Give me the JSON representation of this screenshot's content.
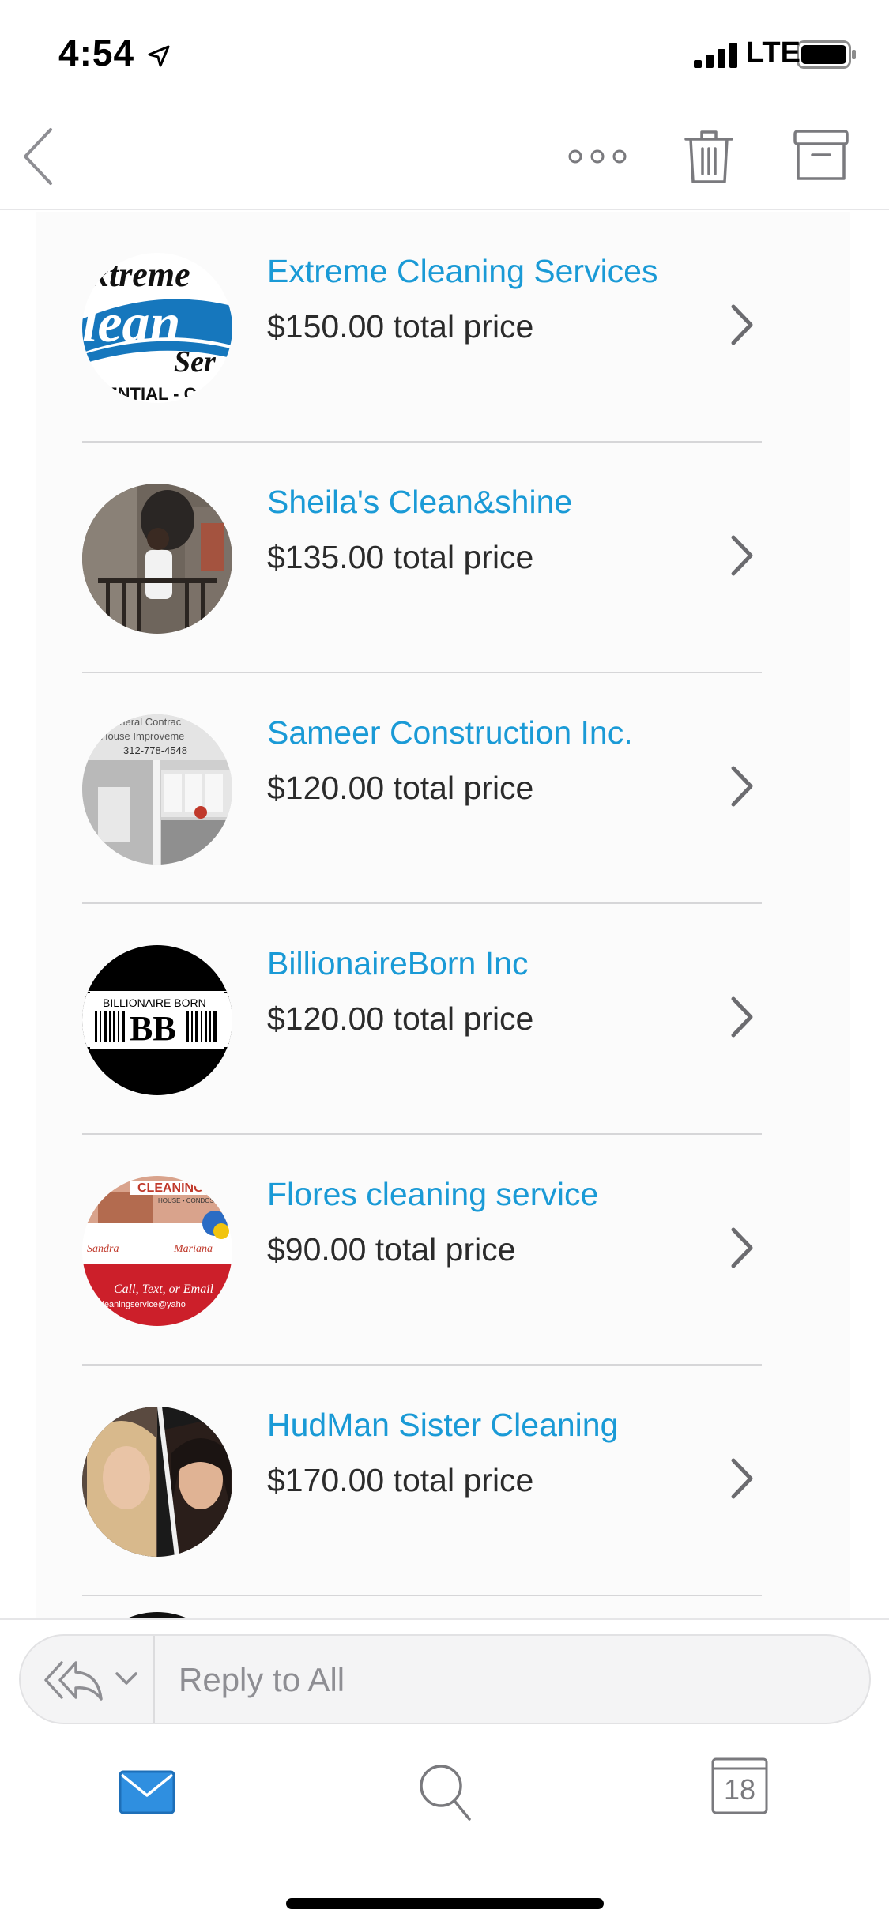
{
  "status_bar": {
    "time": "4:54",
    "carrier": "LTE"
  },
  "nav": {
    "back_icon": "chevron-left-icon",
    "more_icon": "more-dots-icon",
    "trash_icon": "trash-icon",
    "archive_icon": "archive-icon"
  },
  "providers": [
    {
      "name": "Extreme Cleaning Services",
      "price": "$150.00 total price"
    },
    {
      "name": "Sheila's Clean&shine",
      "price": "$135.00 total price"
    },
    {
      "name": "Sameer Construction Inc.",
      "price": "$120.00 total price"
    },
    {
      "name": "BillionaireBorn Inc",
      "price": "$120.00 total price"
    },
    {
      "name": "Flores cleaning service",
      "price": "$90.00 total price"
    },
    {
      "name": "HudMan Sister Cleaning",
      "price": "$170.00 total price"
    }
  ],
  "logo_text": {
    "extreme_top": "xtreme",
    "extreme_mid": "lean",
    "extreme_ser": "Ser",
    "extreme_bottom": "ENTIAL - C",
    "sameer_line1": "eneral Contrac",
    "sameer_line2": "ur House Improveme",
    "sameer_phone": "312-778-4548",
    "billionaire_top": "BILLIONAIRE BORN",
    "billionaire_mark": "BB",
    "flores_banner": "CLEANING S",
    "flores_sub": "HOUSE • CONDOS",
    "flores_left": "Sandra",
    "flores_right": "Mariana",
    "flores_call": "Call, Text, or Email",
    "flores_email": "cleaningservice@yaho"
  },
  "reply": {
    "placeholder": "Reply to All"
  },
  "tabs": {
    "mail_icon": "mail-icon",
    "search_icon": "search-icon",
    "calendar_day": "18"
  },
  "colors": {
    "link_blue": "#1a9ad6",
    "tab_active": "#1e88d9",
    "text_dark": "#2b2b2b",
    "icon_gray": "#7a7a7e"
  }
}
